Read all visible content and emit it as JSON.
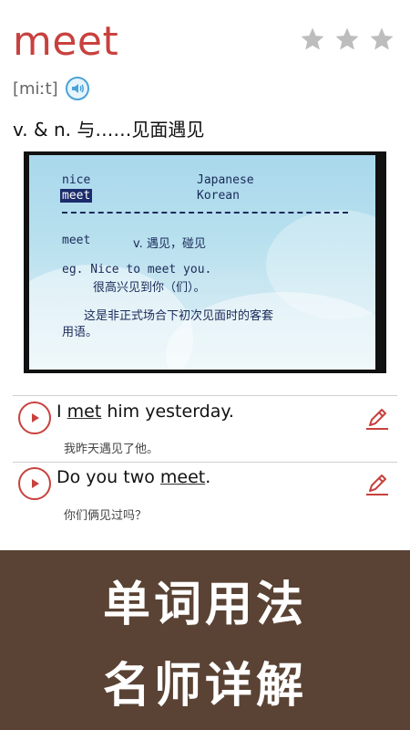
{
  "word": "meet",
  "phonetic": "[miːt]",
  "definition": "v. & n. 与……见面遇见",
  "rating": {
    "filled": 0,
    "total": 3
  },
  "video_slide": {
    "row1_left": "nice",
    "row1_right": "Japanese",
    "row2_left": "meet",
    "row2_right": "Korean",
    "entry_word": "meet",
    "entry_pos": "v. 遇见，碰见",
    "example_en": "eg. Nice to meet you.",
    "example_cn": "很高兴见到你（们）。",
    "note_line1": "这是非正式场合下初次见面时的客套",
    "note_line2": "用语。"
  },
  "examples": [
    {
      "before": "I ",
      "word": "met",
      "after": " him yesterday.",
      "translation": "我昨天遇见了他。"
    },
    {
      "before": "Do you two ",
      "word": "meet",
      "after": ".",
      "translation": "你们俩见过吗？"
    }
  ],
  "banner": {
    "line1": "单词用法",
    "line2": "名师详解"
  },
  "colors": {
    "accent": "#c8413e",
    "banner_bg": "#5a4334",
    "speaker": "#4aa3d8",
    "star": "#bdbdbd"
  }
}
